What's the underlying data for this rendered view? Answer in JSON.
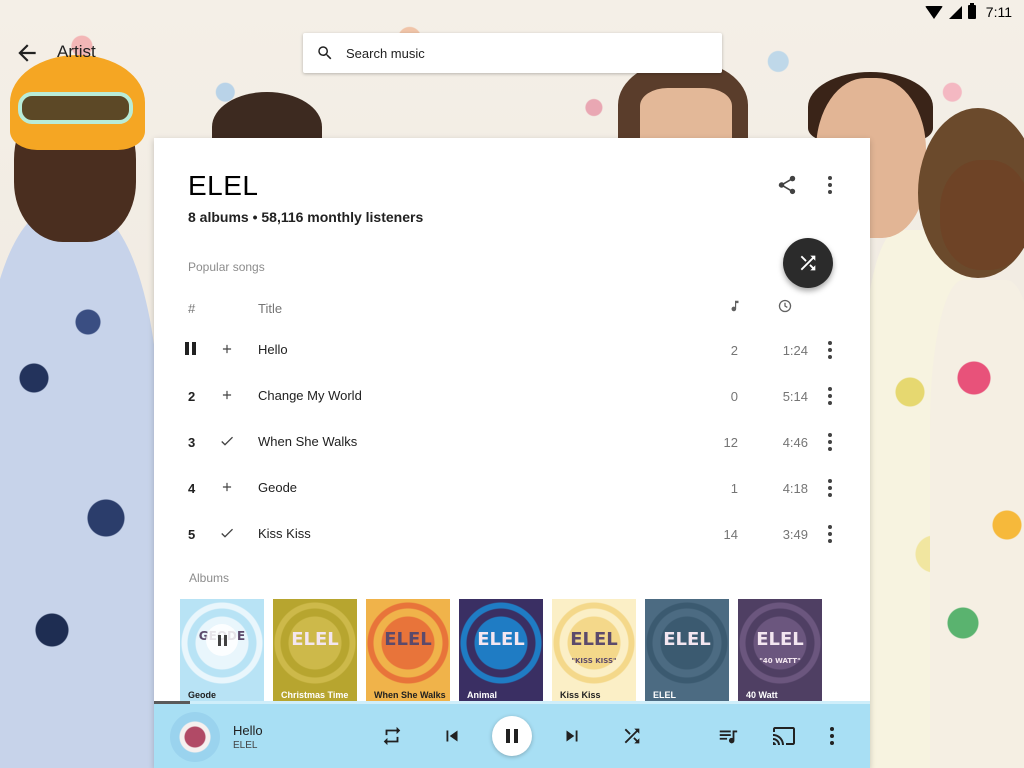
{
  "status_bar": {
    "time": "7:11"
  },
  "toolbar": {
    "title": "Artist",
    "search_placeholder": "Search music"
  },
  "artist": {
    "name": "ELEL",
    "meta": "8 albums • 58,116 monthly listeners"
  },
  "popular": {
    "label": "Popular songs",
    "col_hash": "#",
    "col_title": "Title",
    "songs": [
      {
        "num": "",
        "action": "add",
        "title": "Hello",
        "plays": "2",
        "duration": "1:24",
        "playing": true
      },
      {
        "num": "2",
        "action": "add",
        "title": "Change My World",
        "plays": "0",
        "duration": "5:14",
        "playing": false
      },
      {
        "num": "3",
        "action": "added",
        "title": "When She Walks",
        "plays": "12",
        "duration": "4:46",
        "playing": false
      },
      {
        "num": "4",
        "action": "add",
        "title": "Geode",
        "plays": "1",
        "duration": "4:18",
        "playing": false
      },
      {
        "num": "5",
        "action": "added",
        "title": "Kiss Kiss",
        "plays": "14",
        "duration": "3:49",
        "playing": false
      }
    ]
  },
  "albums": {
    "label": "Albums",
    "items": [
      {
        "title": "Geode",
        "art_text": "GEODE",
        "colors": [
          "#b8e3f5",
          "#e9f6fc"
        ],
        "text_dark": true
      },
      {
        "title": "Christmas Time",
        "art_text": "ELEL",
        "colors": [
          "#b7a52f",
          "#cdb94a"
        ],
        "text_dark": false
      },
      {
        "title": "When She Walks",
        "art_text": "ELEL",
        "colors": [
          "#f0b34a",
          "#e8743a"
        ],
        "text_dark": true
      },
      {
        "title": "Animal",
        "art_text": "ELEL",
        "colors": [
          "#3a2f63",
          "#1f7cc4"
        ],
        "text_dark": false
      },
      {
        "title": "Kiss Kiss",
        "art_text": "ELEL",
        "sub_text": "\"KISS KISS\"",
        "colors": [
          "#fbefc6",
          "#f4d88a"
        ],
        "text_dark": true
      },
      {
        "title": "ELEL",
        "art_text": "ELEL",
        "colors": [
          "#4c6b82",
          "#3b5a70"
        ],
        "text_dark": false
      },
      {
        "title": "40 Watt",
        "art_text": "ELEL",
        "sub_text": "\"40 WATT\"",
        "colors": [
          "#4f3f63",
          "#6b567e"
        ],
        "text_dark": false
      }
    ]
  },
  "now_playing": {
    "title": "Hello",
    "artist": "ELEL",
    "progress": 0.05
  },
  "colors": {
    "player_bg": "#a8dff4",
    "fab_bg": "#2b2b2b",
    "card_bg": "#ffffff"
  },
  "icons": {
    "back": "arrow-left-icon",
    "search": "search-icon",
    "share": "share-icon",
    "more": "more-vert-icon",
    "shuffle": "shuffle-icon",
    "note": "music-note-icon",
    "clock": "clock-icon",
    "add": "plus-icon",
    "added": "check-icon",
    "repeat": "repeat-icon",
    "previous": "skip-previous-icon",
    "next": "skip-next-icon",
    "queue": "queue-music-icon",
    "cast": "cast-icon"
  }
}
